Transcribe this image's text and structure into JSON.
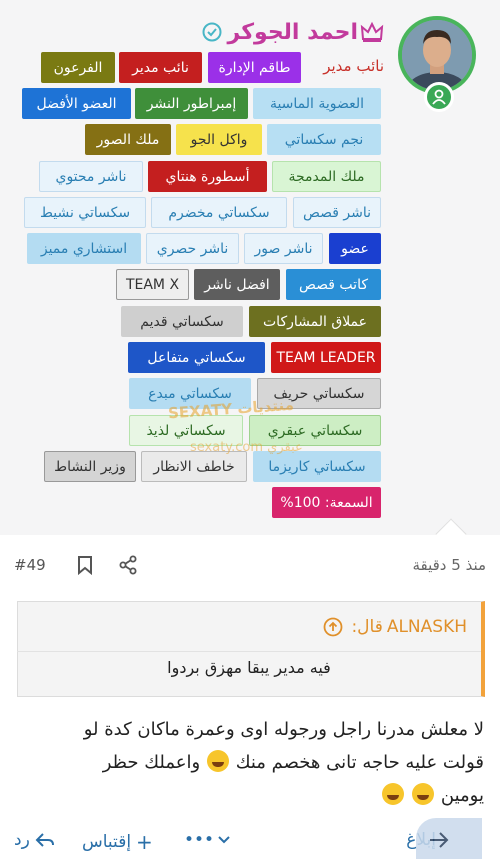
{
  "user": {
    "name": "احمد الجوكر",
    "role": "نائب مدير"
  },
  "badges": [
    {
      "label": "الفرعون"
    },
    {
      "label": "نائب مدير"
    },
    {
      "label": "طاقم الإدارة"
    },
    {
      "label": "العضو الأفضل"
    },
    {
      "label": "إمبراطور النشر"
    },
    {
      "label": "العضوية الماسية"
    },
    {
      "label": "ملك الصور"
    },
    {
      "label": "واكل الجو"
    },
    {
      "label": "نجم سكساتي"
    },
    {
      "label": "ناشر محتوي"
    },
    {
      "label": "أسطورة هنتاي"
    },
    {
      "label": "ملك المدمجة"
    },
    {
      "label": "سكساتي نشيط"
    },
    {
      "label": "سكساتي مخضرم"
    },
    {
      "label": "ناشر قصص"
    },
    {
      "label": "استشاري مميز"
    },
    {
      "label": "ناشر حصري"
    },
    {
      "label": "ناشر صور"
    },
    {
      "label": "عضو"
    },
    {
      "label": "TEAM X"
    },
    {
      "label": "افضل ناشر"
    },
    {
      "label": "كاتب قصص"
    },
    {
      "label": "سكساتي قديم"
    },
    {
      "label": "عملاق المشاركات"
    },
    {
      "label": "سكساتي متفاعل"
    },
    {
      "label": "TEAM LEADER"
    },
    {
      "label": "سكساتي مبدع"
    },
    {
      "label": "سكساتي حريف"
    },
    {
      "label": "سكساتي لذيذ"
    },
    {
      "label": "سكساتي عبقري"
    },
    {
      "label": "وزير النشاط"
    },
    {
      "label": "خاطف الانظار"
    },
    {
      "label": "سكساتي كاريزما"
    },
    {
      "label": "السمعة: 100%"
    }
  ],
  "watermark": {
    "line1": "SEXATY منتديات",
    "line2": "sexaty.com عبقري"
  },
  "meta": {
    "post_number": "#49",
    "time": "منذ 5 دقيقة"
  },
  "quote": {
    "author": "ALNASKH",
    "said": "قال:",
    "text": "فيه مدير يبقا مهزق بردوا"
  },
  "post": {
    "line1": "لا معلش مدرنا راجل ورجوله اوى وعمرة ماكان كدة لو",
    "line2a": "قولت عليه حاجه تانى هخصم منك",
    "line2b": "واعملك حظر",
    "line3": "يومين"
  },
  "actions": {
    "reply": "رد",
    "quote": "إقتباس",
    "more": "•••",
    "report": "إبلاغ"
  },
  "colors": {
    "accent": "#2a6fa8",
    "quote_border": "#f2a23b",
    "username": "#c23a9c",
    "role": "#c8312a"
  }
}
